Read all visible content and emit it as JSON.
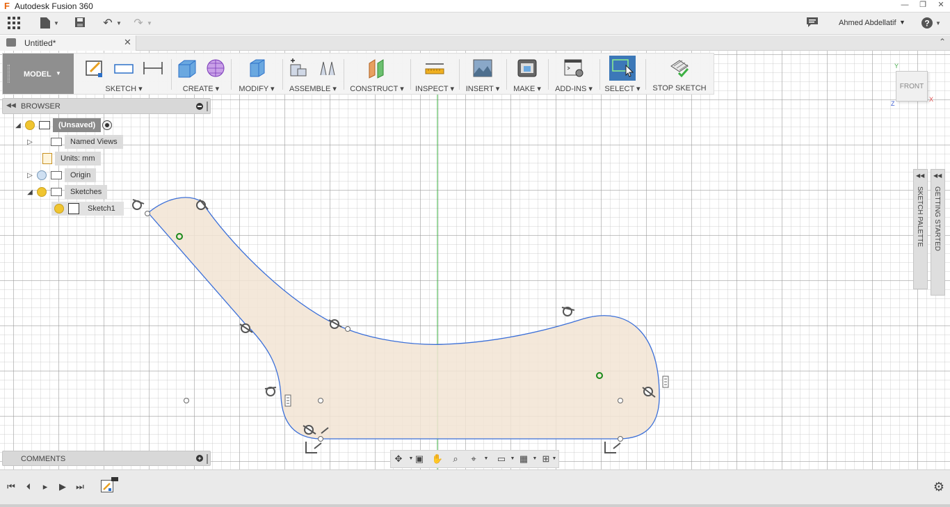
{
  "window": {
    "title": "Autodesk Fusion 360",
    "controls": [
      "minimize",
      "restore",
      "close"
    ]
  },
  "quick_access": {
    "icons": [
      "apps-grid-icon",
      "file-icon",
      "save-icon",
      "undo-icon",
      "redo-icon"
    ],
    "user": "Ahmed Abdellatif",
    "help": "?"
  },
  "document_tab": {
    "label": "Untitled*"
  },
  "toolbar": {
    "workspace": "MODEL",
    "groups": [
      {
        "label": "SKETCH",
        "icons": [
          "create-sketch-icon",
          "rectangle-icon",
          "dimension-icon"
        ]
      },
      {
        "label": "CREATE",
        "icons": [
          "extrude-icon",
          "form-icon"
        ]
      },
      {
        "label": "MODIFY",
        "icons": [
          "press-pull-icon"
        ]
      },
      {
        "label": "ASSEMBLE",
        "icons": [
          "new-component-icon",
          "joint-icon"
        ]
      },
      {
        "label": "CONSTRUCT",
        "icons": [
          "offset-plane-icon"
        ]
      },
      {
        "label": "INSPECT",
        "icons": [
          "measure-icon"
        ]
      },
      {
        "label": "INSERT",
        "icons": [
          "insert-image-icon"
        ]
      },
      {
        "label": "MAKE",
        "icons": [
          "print-3d-icon"
        ]
      },
      {
        "label": "ADD-INS",
        "icons": [
          "scripts-icon"
        ]
      },
      {
        "label": "SELECT",
        "icons": [
          "select-window-icon"
        ]
      },
      {
        "label": "STOP SKETCH",
        "icons": [
          "stop-sketch-icon"
        ]
      }
    ]
  },
  "browser": {
    "title": "BROWSER",
    "root": "(Unsaved)",
    "items": [
      {
        "label": "Named Views"
      },
      {
        "label": "Units: mm"
      },
      {
        "label": "Origin"
      },
      {
        "label": "Sketches"
      },
      {
        "label": "Sketch1"
      }
    ]
  },
  "comments": {
    "title": "COMMENTS"
  },
  "viewcube": {
    "face": "FRONT",
    "axes": {
      "x": "X",
      "y": "Y",
      "z": "Z"
    }
  },
  "side_panels": {
    "sketch_palette": "SKETCH PALETTE",
    "getting_started": "GETTING STARTED"
  },
  "colors": {
    "sketch_line": "#3b6fd8",
    "profile_fill": "#f2e4d4",
    "axis_green": "#3cb043",
    "constraint_gray": "#555555",
    "point_green": "#1a8a1a"
  },
  "nav_bar": {
    "icons": [
      "orbit-icon",
      "look-at-icon",
      "pan-icon",
      "zoom-icon",
      "fit-icon",
      "display-settings-icon",
      "grid-icon",
      "viewports-icon"
    ]
  },
  "timeline": {
    "icons": [
      "go-to-start-icon",
      "step-back-icon",
      "play-icon",
      "step-forward-icon",
      "go-to-end-icon"
    ]
  }
}
